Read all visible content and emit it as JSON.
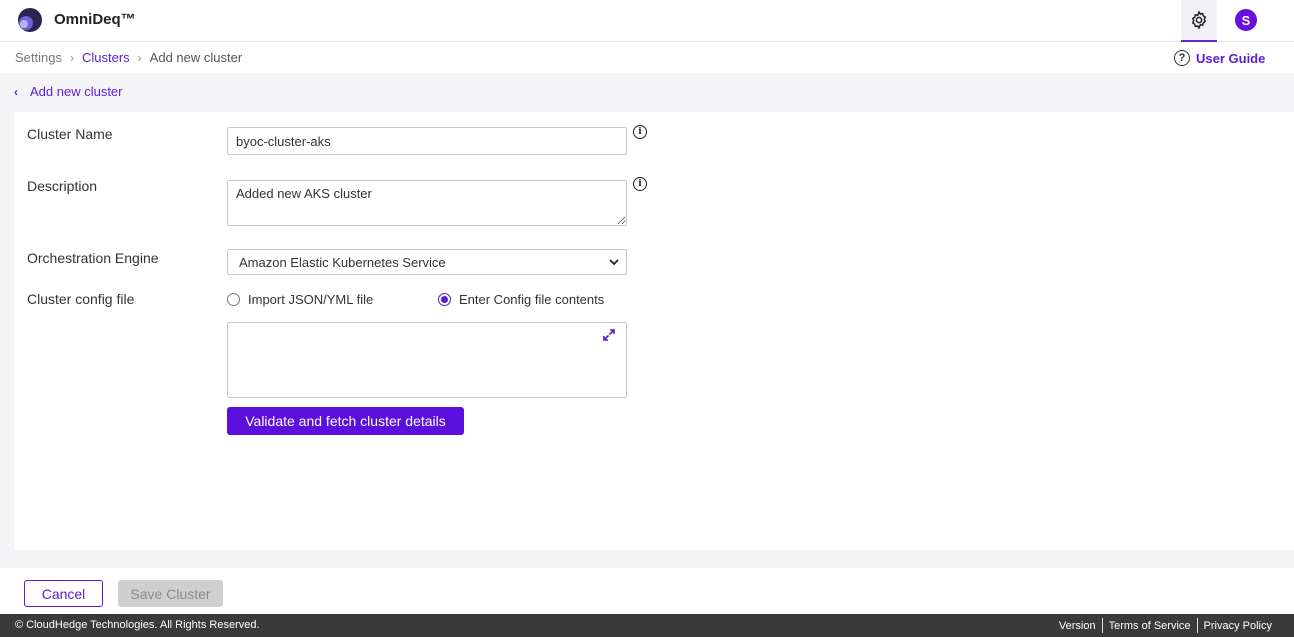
{
  "header": {
    "brand": "OmniDeq™",
    "avatar_initial": "S"
  },
  "breadcrumb": {
    "items": [
      "Settings",
      "Clusters",
      "Add new cluster"
    ],
    "separator": "›"
  },
  "user_guide_label": "User Guide",
  "back_label": "Add new cluster",
  "form": {
    "cluster_name": {
      "label": "Cluster Name",
      "value": "byoc-cluster-aks"
    },
    "description": {
      "label": "Description",
      "value": "Added new AKS cluster"
    },
    "orchestration_engine": {
      "label": "Orchestration Engine",
      "selected": "Amazon Elastic Kubernetes Service"
    },
    "config_file": {
      "label": "Cluster config file",
      "options": [
        "Import JSON/YML file",
        "Enter Config file contents"
      ],
      "selected_index": 1,
      "contents": ""
    },
    "validate_label": "Validate and fetch cluster details"
  },
  "actions": {
    "cancel_label": "Cancel",
    "save_label": "Save Cluster"
  },
  "footer": {
    "copyright": "© CloudHedge Technologies. All Rights Reserved.",
    "links": [
      "Version",
      "Terms of Service",
      "Privacy Policy"
    ]
  },
  "colors": {
    "accent": "#5b1bd6",
    "primary_button": "#5b0fdc",
    "footer_bg": "#3a3a3a"
  }
}
